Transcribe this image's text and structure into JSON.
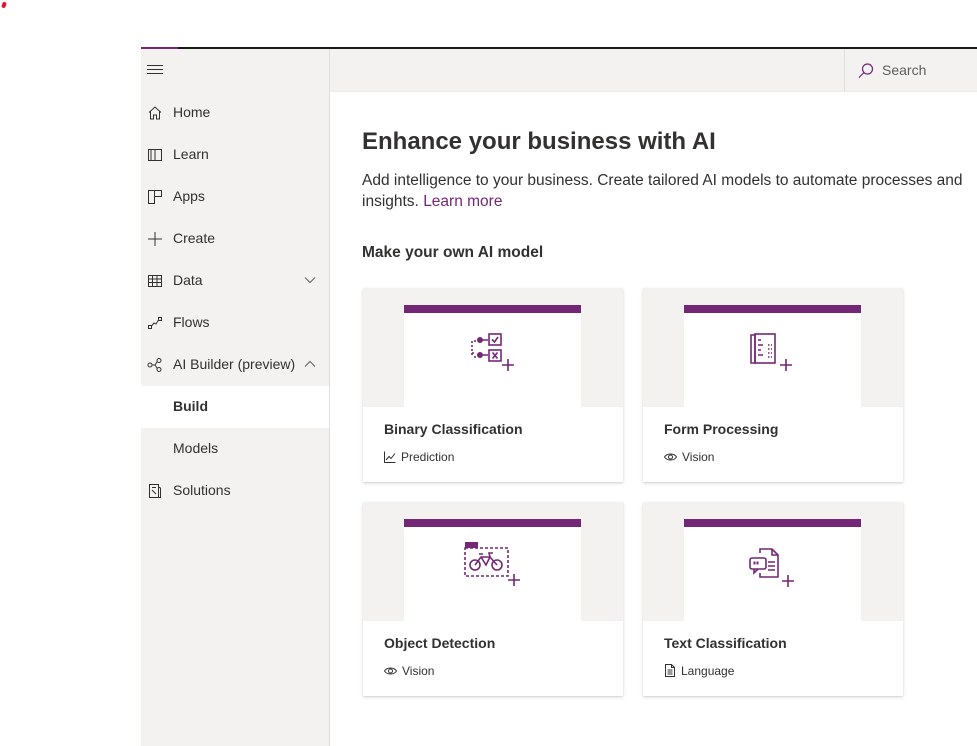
{
  "sidebar": {
    "items": [
      {
        "label": "Home",
        "icon": "home-icon"
      },
      {
        "label": "Learn",
        "icon": "book-icon"
      },
      {
        "label": "Apps",
        "icon": "apps-icon"
      },
      {
        "label": "Create",
        "icon": "plus-icon"
      },
      {
        "label": "Data",
        "icon": "table-icon",
        "expanded": false
      },
      {
        "label": "Flows",
        "icon": "flow-icon"
      },
      {
        "label": "AI Builder (preview)",
        "icon": "ai-builder-icon",
        "expanded": true
      },
      {
        "label": "Build",
        "selected": true
      },
      {
        "label": "Models"
      },
      {
        "label": "Solutions",
        "icon": "solutions-icon"
      }
    ]
  },
  "search": {
    "label": "Search"
  },
  "main": {
    "title": "Enhance your business with AI",
    "description": "Add intelligence to your business. Create tailored AI models to automate processes and",
    "description_cont": "insights.",
    "learn_more": "Learn more",
    "section_title": "Make your own AI model",
    "cards": [
      {
        "title": "Binary Classification",
        "tag": "Prediction",
        "icon": "binary-classification-icon",
        "tag_icon": "chart-icon"
      },
      {
        "title": "Form Processing",
        "tag": "Vision",
        "icon": "form-processing-icon",
        "tag_icon": "eye-icon"
      },
      {
        "title": "Object Detection",
        "tag": "Vision",
        "icon": "object-detection-icon",
        "tag_icon": "eye-icon"
      },
      {
        "title": "Text Classification",
        "tag": "Language",
        "icon": "text-classification-icon",
        "tag_icon": "document-icon"
      }
    ]
  },
  "colors": {
    "accent": "#742774",
    "nav_bg": "#f3f2f1",
    "text": "#323130"
  }
}
